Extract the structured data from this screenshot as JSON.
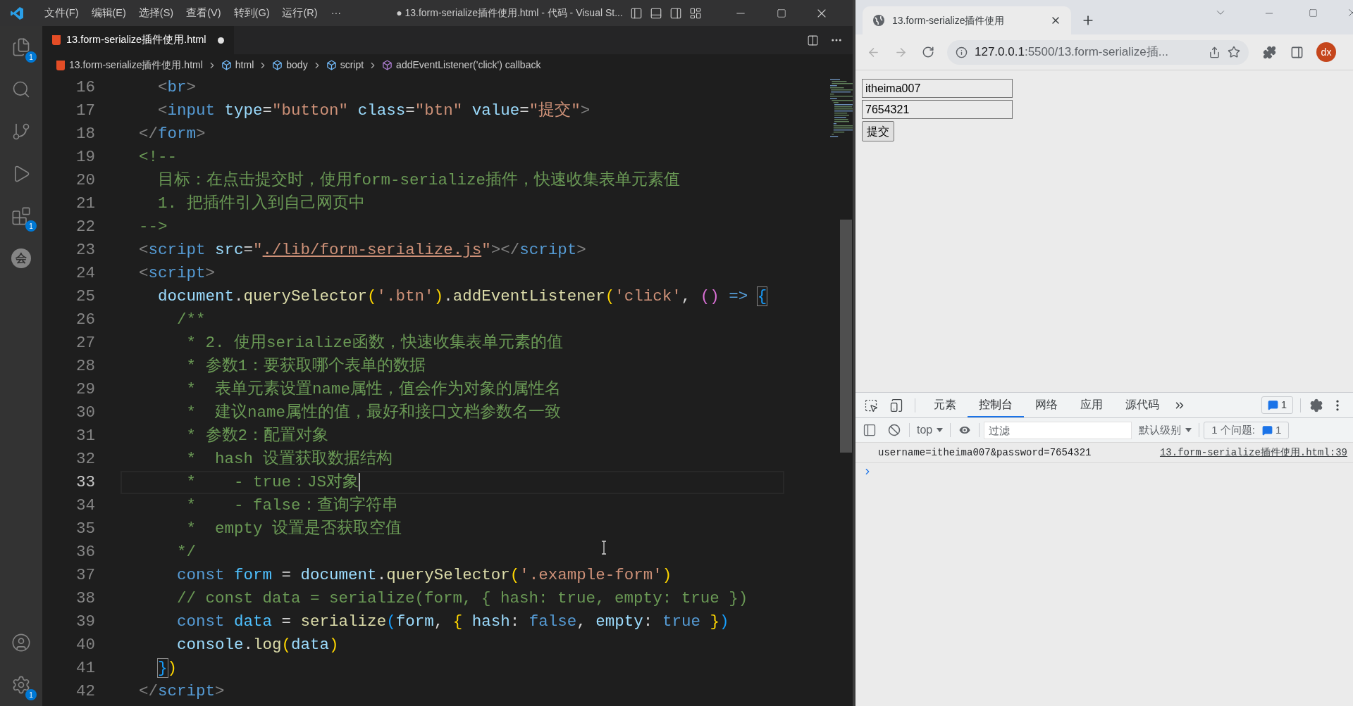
{
  "vscode": {
    "menu": [
      "文件(F)",
      "编辑(E)",
      "选择(S)",
      "查看(V)",
      "转到(G)",
      "运行(R)"
    ],
    "menu_more": "···",
    "title": "● 13.form-serialize插件使用.html - 代码 - Visual St...",
    "activity": [
      {
        "kind": "explorer",
        "badge": "1"
      },
      {
        "kind": "search"
      },
      {
        "kind": "git"
      },
      {
        "kind": "run"
      },
      {
        "kind": "extensions",
        "badge": "1"
      },
      {
        "kind": "glyph",
        "label": "会"
      }
    ],
    "activity_bottom": [
      {
        "kind": "account"
      },
      {
        "kind": "settings",
        "badge": "1"
      }
    ],
    "tab": {
      "label": "13.form-serialize插件使用.html",
      "dirty": true
    },
    "breadcrumb": [
      {
        "kind": "file",
        "label": "13.form-serialize插件使用.html"
      },
      {
        "kind": "element",
        "label": "html"
      },
      {
        "kind": "element",
        "label": "body"
      },
      {
        "kind": "element",
        "label": "script"
      },
      {
        "kind": "method",
        "label": "addEventListener('click') callback"
      }
    ],
    "lines": [
      {
        "number": "16",
        "selected": false,
        "tokens": [
          {
            "kind": "punct",
            "text": "  <"
          },
          {
            "kind": "tag",
            "text": "br"
          },
          {
            "kind": "punct",
            "text": ">"
          }
        ]
      },
      {
        "number": "17",
        "selected": false,
        "tokens": [
          {
            "kind": "punct",
            "text": "  <"
          },
          {
            "kind": "tag",
            "text": "input"
          },
          {
            "kind": "attr",
            "text": " type"
          },
          {
            "kind": "text",
            "text": "="
          },
          {
            "kind": "string",
            "text": "\"button\""
          },
          {
            "kind": "attr",
            "text": " class"
          },
          {
            "kind": "text",
            "text": "="
          },
          {
            "kind": "string",
            "text": "\"btn\""
          },
          {
            "kind": "attr",
            "text": " value"
          },
          {
            "kind": "text",
            "text": "="
          },
          {
            "kind": "string",
            "text": "\"提交\""
          },
          {
            "kind": "punct",
            "text": ">"
          }
        ]
      },
      {
        "number": "18",
        "selected": false,
        "tokens": [
          {
            "kind": "punct",
            "text": "</"
          },
          {
            "kind": "tag",
            "text": "form"
          },
          {
            "kind": "punct",
            "text": ">"
          }
        ]
      },
      {
        "number": "19",
        "selected": false,
        "tokens": [
          {
            "kind": "comment",
            "text": "<!--"
          }
        ]
      },
      {
        "number": "20",
        "selected": false,
        "tokens": [
          {
            "kind": "comment",
            "text": "  目标：在点击提交时，使用form-serialize插件，快速收集表单元素值"
          }
        ]
      },
      {
        "number": "21",
        "selected": false,
        "tokens": [
          {
            "kind": "comment",
            "text": "  1. 把插件引入到自己网页中"
          }
        ]
      },
      {
        "number": "22",
        "selected": false,
        "tokens": [
          {
            "kind": "comment",
            "text": "-->"
          }
        ]
      },
      {
        "number": "23",
        "selected": false,
        "tokens": [
          {
            "kind": "punct",
            "text": "<"
          },
          {
            "kind": "tag",
            "text": "script"
          },
          {
            "kind": "attr",
            "text": " src"
          },
          {
            "kind": "text",
            "text": "="
          },
          {
            "kind": "string",
            "text": "\""
          },
          {
            "kind": "link",
            "text": "./lib/form-serialize.js"
          },
          {
            "kind": "string",
            "text": "\""
          },
          {
            "kind": "punct",
            "text": "></"
          },
          {
            "kind": "tag",
            "text": "script"
          },
          {
            "kind": "punct",
            "text": ">"
          }
        ]
      },
      {
        "number": "24",
        "selected": false,
        "tokens": [
          {
            "kind": "punct",
            "text": "<"
          },
          {
            "kind": "tag",
            "text": "script"
          },
          {
            "kind": "punct",
            "text": ">"
          }
        ]
      },
      {
        "number": "25",
        "selected": false,
        "tokens": [
          {
            "kind": "prop",
            "text": "  document"
          },
          {
            "kind": "text",
            "text": "."
          },
          {
            "kind": "func",
            "text": "querySelector"
          },
          {
            "kind": "gold",
            "text": "("
          },
          {
            "kind": "string",
            "text": "'.btn'"
          },
          {
            "kind": "gold",
            "text": ")"
          },
          {
            "kind": "text",
            "text": "."
          },
          {
            "kind": "func",
            "text": "addEventListener"
          },
          {
            "kind": "gold",
            "text": "("
          },
          {
            "kind": "string",
            "text": "'click'"
          },
          {
            "kind": "text",
            "text": ", "
          },
          {
            "kind": "purple",
            "text": "()"
          },
          {
            "kind": "keyword",
            "text": " => "
          },
          {
            "kind": "match",
            "text": "{"
          }
        ]
      },
      {
        "number": "26",
        "selected": false,
        "tokens": [
          {
            "kind": "comment",
            "text": "    /**"
          }
        ]
      },
      {
        "number": "27",
        "selected": false,
        "tokens": [
          {
            "kind": "comment",
            "text": "     * 2. 使用serialize函数，快速收集表单元素的值"
          }
        ]
      },
      {
        "number": "28",
        "selected": false,
        "tokens": [
          {
            "kind": "comment",
            "text": "     * 参数1：要获取哪个表单的数据"
          }
        ]
      },
      {
        "number": "29",
        "selected": false,
        "tokens": [
          {
            "kind": "comment",
            "text": "     *  表单元素设置name属性，值会作为对象的属性名"
          }
        ]
      },
      {
        "number": "30",
        "selected": false,
        "tokens": [
          {
            "kind": "comment",
            "text": "     *  建议name属性的值，最好和接口文档参数名一致"
          }
        ]
      },
      {
        "number": "31",
        "selected": false,
        "tokens": [
          {
            "kind": "comment",
            "text": "     * 参数2：配置对象"
          }
        ]
      },
      {
        "number": "32",
        "selected": false,
        "tokens": [
          {
            "kind": "comment",
            "text": "     *  hash 设置获取数据结构"
          }
        ]
      },
      {
        "number": "33",
        "selected": true,
        "tokens": [
          {
            "kind": "comment",
            "text": "     *    - true：JS对象"
          }
        ]
      },
      {
        "number": "34",
        "selected": false,
        "tokens": [
          {
            "kind": "comment",
            "text": "     *    - false：查询字符串"
          }
        ]
      },
      {
        "number": "35",
        "selected": false,
        "tokens": [
          {
            "kind": "comment",
            "text": "     *  empty 设置是否获取空值"
          }
        ]
      },
      {
        "number": "36",
        "selected": false,
        "tokens": [
          {
            "kind": "comment",
            "text": "    */"
          }
        ]
      },
      {
        "number": "37",
        "selected": false,
        "tokens": [
          {
            "kind": "keyword",
            "text": "    const"
          },
          {
            "kind": "var",
            "text": " form"
          },
          {
            "kind": "text",
            "text": " = "
          },
          {
            "kind": "prop",
            "text": "document"
          },
          {
            "kind": "text",
            "text": "."
          },
          {
            "kind": "func",
            "text": "querySelector"
          },
          {
            "kind": "gold",
            "text": "("
          },
          {
            "kind": "string",
            "text": "'.example-form'"
          },
          {
            "kind": "gold",
            "text": ")"
          }
        ]
      },
      {
        "number": "38",
        "selected": false,
        "tokens": [
          {
            "kind": "comment",
            "text": "    // const data = serialize(form, { hash: true, empty: true })"
          }
        ]
      },
      {
        "number": "39",
        "selected": false,
        "tokens": [
          {
            "kind": "keyword",
            "text": "    const"
          },
          {
            "kind": "var",
            "text": " data"
          },
          {
            "kind": "text",
            "text": " = "
          },
          {
            "kind": "func",
            "text": "serialize"
          },
          {
            "kind": "blue",
            "text": "("
          },
          {
            "kind": "prop",
            "text": "form"
          },
          {
            "kind": "text",
            "text": ", "
          },
          {
            "kind": "gold",
            "text": "{"
          },
          {
            "kind": "prop",
            "text": " hash"
          },
          {
            "kind": "text",
            "text": ": "
          },
          {
            "kind": "keyword",
            "text": "false"
          },
          {
            "kind": "text",
            "text": ", "
          },
          {
            "kind": "prop",
            "text": "empty"
          },
          {
            "kind": "text",
            "text": ": "
          },
          {
            "kind": "keyword",
            "text": "true"
          },
          {
            "kind": "gold",
            "text": " }"
          },
          {
            "kind": "blue",
            "text": ")"
          }
        ]
      },
      {
        "number": "40",
        "selected": false,
        "tokens": [
          {
            "kind": "prop",
            "text": "    console"
          },
          {
            "kind": "text",
            "text": "."
          },
          {
            "kind": "func",
            "text": "log"
          },
          {
            "kind": "gold",
            "text": "("
          },
          {
            "kind": "prop",
            "text": "data"
          },
          {
            "kind": "gold",
            "text": ")"
          }
        ]
      },
      {
        "number": "41",
        "selected": false,
        "tokens": [
          {
            "kind": "match",
            "text": "  }"
          },
          {
            "kind": "gold",
            "text": ")"
          }
        ]
      },
      {
        "number": "42",
        "selected": false,
        "tokens": [
          {
            "kind": "punct",
            "text": "</"
          },
          {
            "kind": "tag",
            "text": "script"
          },
          {
            "kind": "punct",
            "text": ">"
          }
        ]
      }
    ]
  },
  "browser": {
    "tab_title": "13.form-serialize插件使用",
    "url_host": "127.0.0.1",
    "url_rest": ":5500/13.form-serialize插...",
    "avatar": "dx",
    "fields": [
      {
        "value": "itheima007"
      },
      {
        "value": "7654321"
      }
    ],
    "submit": "提交",
    "devtools": {
      "tabs": [
        {
          "label": "元素",
          "selected": false
        },
        {
          "label": "控制台",
          "selected": true
        },
        {
          "label": "网络",
          "selected": false
        },
        {
          "label": "应用",
          "selected": false
        },
        {
          "label": "源代码",
          "selected": false
        }
      ],
      "issues_badge": "1",
      "context": "top",
      "filter_placeholder": "过滤",
      "level": "默认级别",
      "issues_label": "1 个问题:",
      "issues_count": "1",
      "log": {
        "message": "username=itheima007&password=7654321",
        "source": "13.form-serialize插件使用.html:39"
      }
    }
  }
}
